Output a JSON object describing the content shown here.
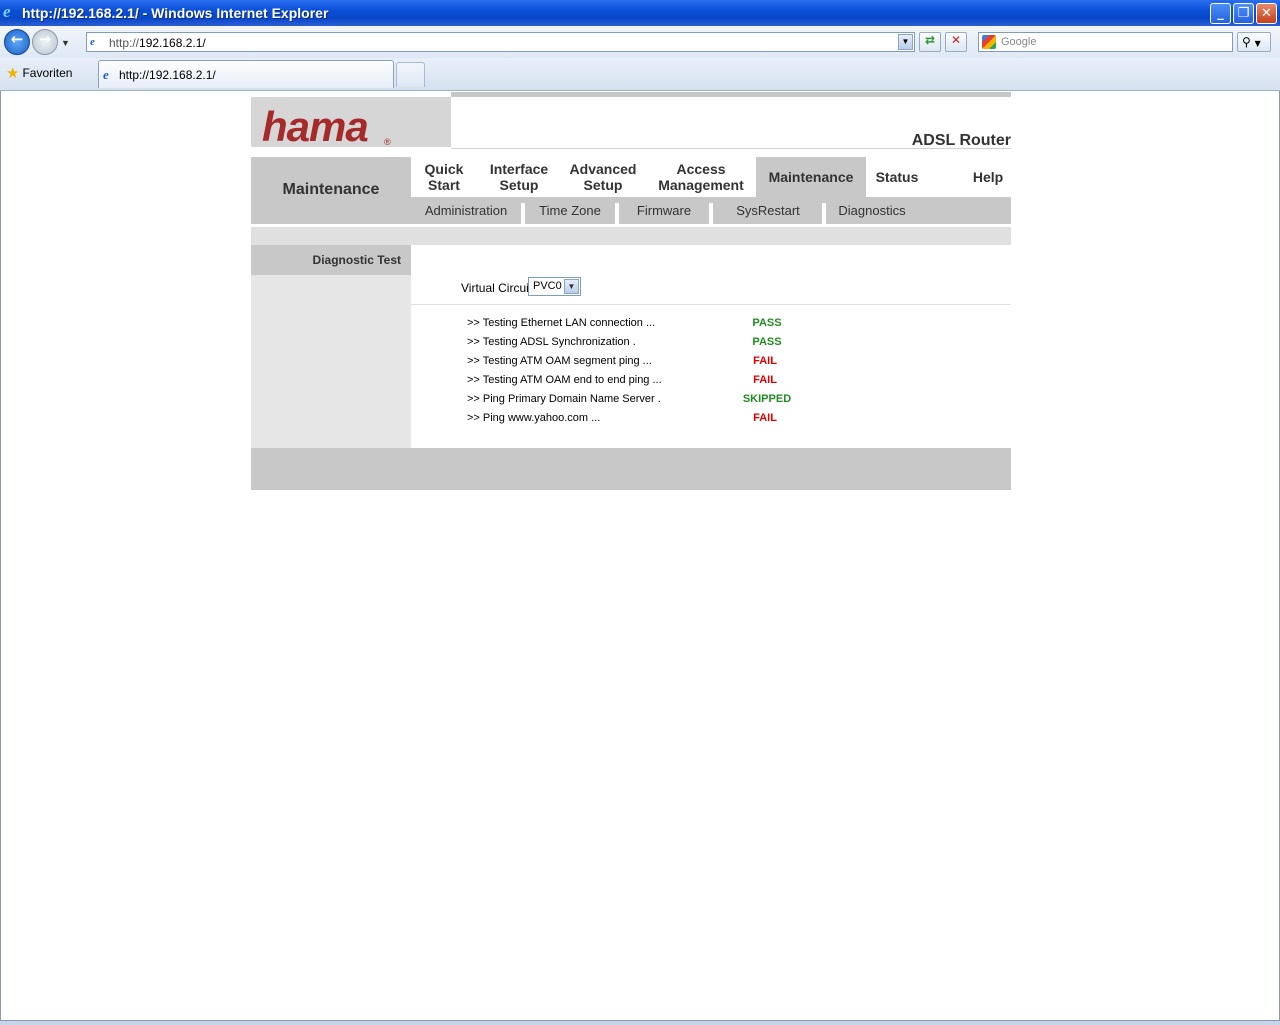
{
  "window": {
    "title": "http://192.168.2.1/ - Windows Internet Explorer",
    "min_label": "_",
    "max_label": "❐",
    "close_label": "✕"
  },
  "browser": {
    "address_prefix": "http://",
    "address_host": "192.168.2.1/",
    "search_placeholder": "Google",
    "favorites_label": "Favoriten",
    "tab_title": "http://192.168.2.1/"
  },
  "router": {
    "logo_text": "hama",
    "product": "ADSL Router",
    "section_title": "Maintenance",
    "menu": [
      {
        "label": "Quick Start"
      },
      {
        "label": "Interface Setup"
      },
      {
        "label": "Advanced Setup"
      },
      {
        "label": "Access Management"
      },
      {
        "label": "Maintenance"
      },
      {
        "label": "Status"
      },
      {
        "label": "Help"
      }
    ],
    "submenu": [
      {
        "label": "Administration"
      },
      {
        "label": "Time Zone"
      },
      {
        "label": "Firmware"
      },
      {
        "label": "SysRestart"
      },
      {
        "label": "Diagnostics"
      }
    ],
    "left_heading": "Diagnostic Test",
    "virtual_circuit_label": "Virtual Circuit:",
    "virtual_circuit_value": "PVC0",
    "tests": [
      {
        "name": ">> Testing Ethernet LAN connection ...",
        "result": "PASS"
      },
      {
        "name": ">> Testing ADSL Synchronization .",
        "result": "PASS"
      },
      {
        "name": ">> Testing ATM OAM segment ping ...",
        "result": "FAIL"
      },
      {
        "name": ">> Testing ATM OAM end to end ping ...",
        "result": "FAIL"
      },
      {
        "name": ">> Ping Primary Domain Name Server .",
        "result": "SKIPPED"
      },
      {
        "name": ">> Ping www.yahoo.com ...",
        "result": "FAIL"
      }
    ]
  }
}
